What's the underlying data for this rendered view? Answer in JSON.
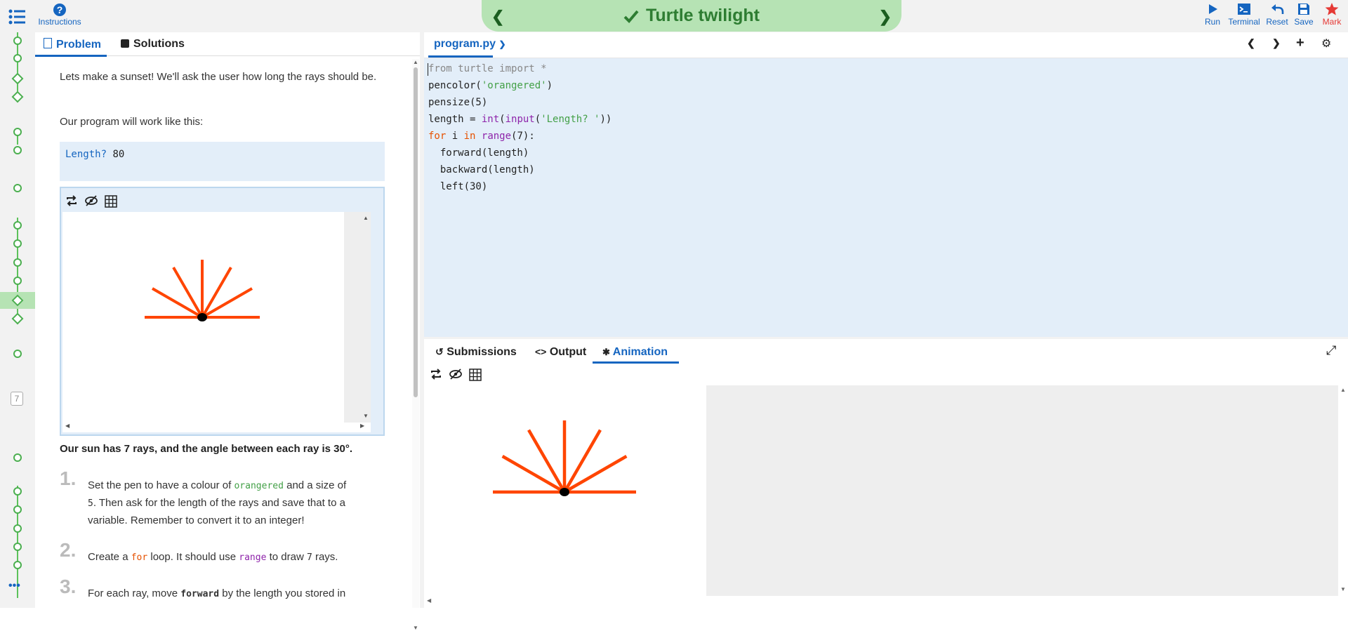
{
  "top": {
    "instructions_label": "Instructions",
    "title": "Turtle twilight",
    "tools": {
      "run": "Run",
      "terminal": "Terminal",
      "reset": "Reset",
      "save": "Save",
      "mark": "Mark"
    }
  },
  "rail": {
    "number_badge": "7",
    "more": "•••"
  },
  "problem": {
    "tabs": {
      "problem": "Problem",
      "solutions": "Solutions"
    },
    "intro": "Lets make a sunset! We'll ask the user how long the rays should be.",
    "works_like": "Our program will work like this:",
    "example": {
      "prompt": "Length? ",
      "value": "80"
    },
    "sun_summary": "Our sun has 7 rays, and the angle between each ray is 30°.",
    "steps": [
      {
        "num": "1.",
        "a": "Set the pen to have a colour of ",
        "code1": "orangered",
        "b": " and a size of ",
        "code2": "5",
        "c": ". Then ask for the length of the rays and save that to a variable. Remember to convert it to an integer!"
      },
      {
        "num": "2.",
        "a": "Create a ",
        "code1": "for",
        "b": " loop. It should use ",
        "code2": "range",
        "c": " to draw ",
        "code3": "7",
        "d": " rays."
      },
      {
        "num": "3.",
        "a": "For each ray, move ",
        "code1": "forward",
        "b": " by the length you stored in"
      }
    ]
  },
  "editor": {
    "filename": "program.py",
    "lines": [
      [
        {
          "t": "from",
          "c": "cm"
        },
        {
          "t": " turtle ",
          "c": "cm"
        },
        {
          "t": "import",
          "c": "cm"
        },
        {
          "t": " *",
          "c": "cm"
        }
      ],
      [
        {
          "t": "pencolor(",
          "c": ""
        },
        {
          "t": "'orangered'",
          "c": "str"
        },
        {
          "t": ")",
          "c": ""
        }
      ],
      [
        {
          "t": "pensize(5)",
          "c": ""
        }
      ],
      [
        {
          "t": "length = ",
          "c": ""
        },
        {
          "t": "int",
          "c": "bi"
        },
        {
          "t": "(",
          "c": ""
        },
        {
          "t": "input",
          "c": "bi"
        },
        {
          "t": "(",
          "c": ""
        },
        {
          "t": "'Length? '",
          "c": "str"
        },
        {
          "t": "))",
          "c": ""
        }
      ],
      [
        {
          "t": "for",
          "c": "kw"
        },
        {
          "t": " i ",
          "c": ""
        },
        {
          "t": "in",
          "c": "kw"
        },
        {
          "t": " ",
          "c": ""
        },
        {
          "t": "range",
          "c": "bi"
        },
        {
          "t": "(7):",
          "c": ""
        }
      ],
      [
        {
          "t": "  forward(length)",
          "c": ""
        }
      ],
      [
        {
          "t": "  backward(length)",
          "c": ""
        }
      ],
      [
        {
          "t": "  left(30)",
          "c": ""
        }
      ]
    ]
  },
  "bottom": {
    "tabs": {
      "submissions": "Submissions",
      "output": "Output",
      "animation": "Animation"
    }
  },
  "colors": {
    "accent": "#1565c0",
    "success": "#4caf50",
    "ray": "#ff4500",
    "panel": "#e3eef9"
  },
  "turtle": {
    "rays": 7,
    "angle_deg": 30
  }
}
